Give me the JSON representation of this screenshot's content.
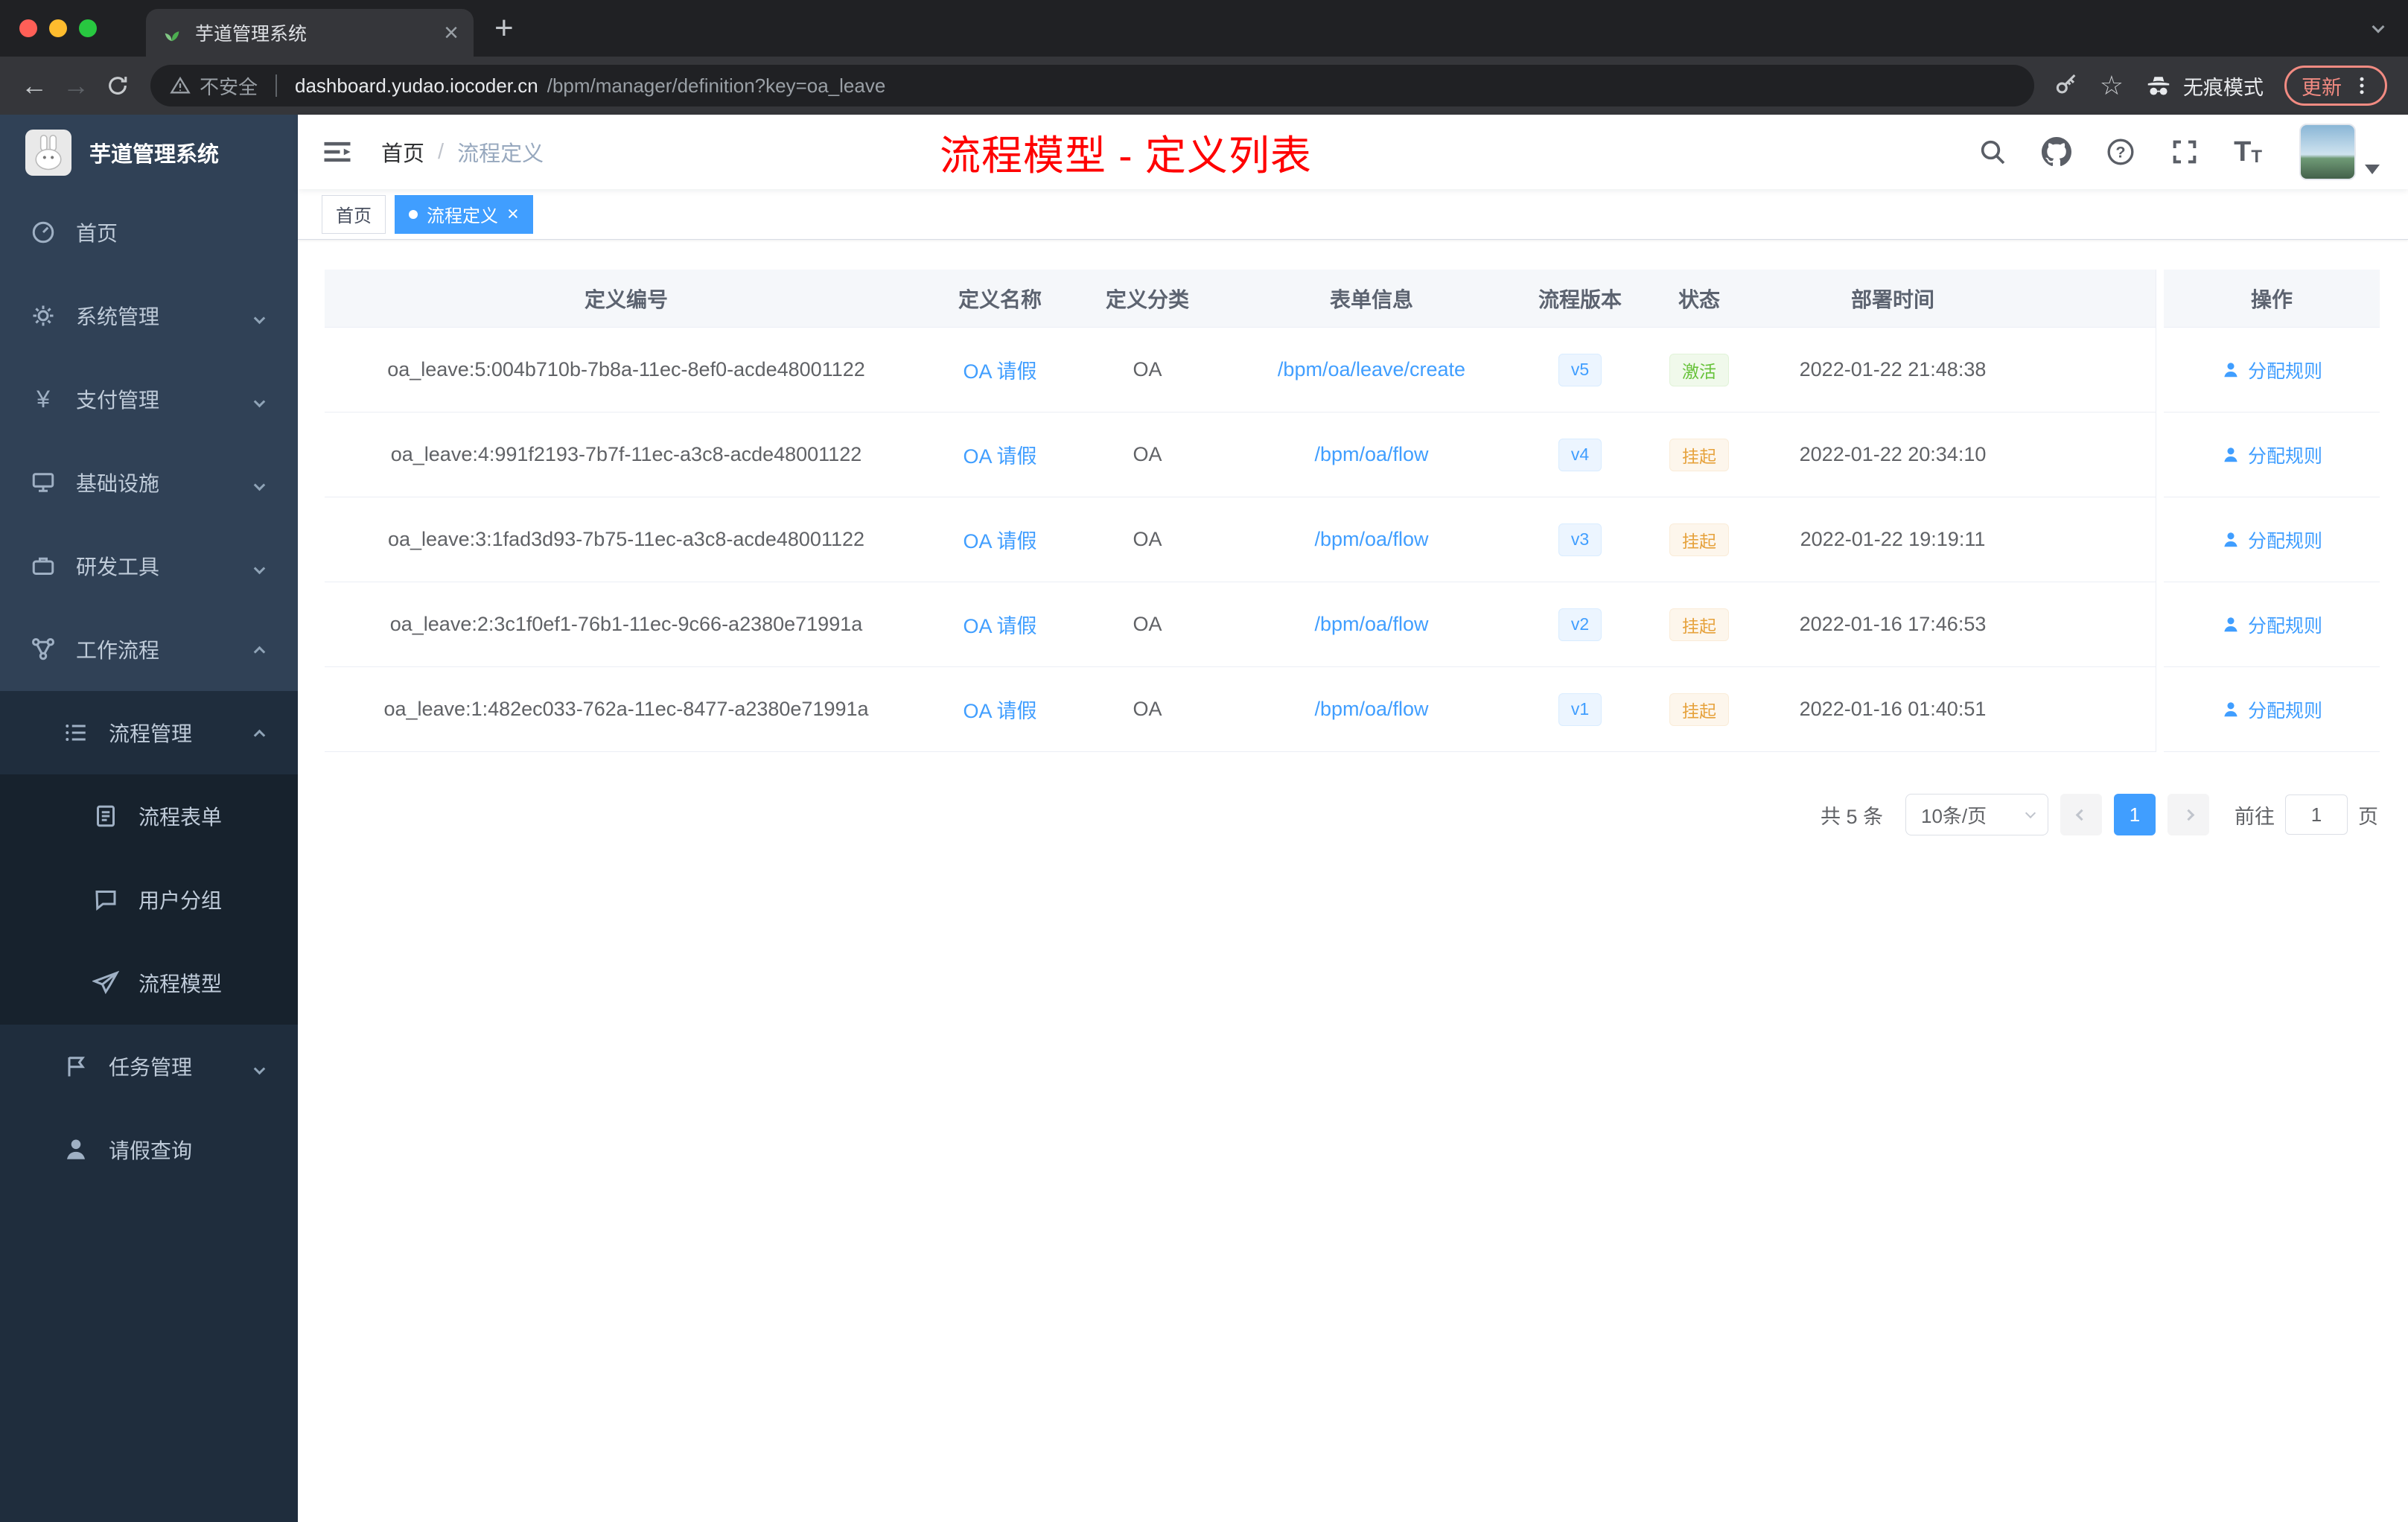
{
  "colors": {
    "primary": "#409eff",
    "success": "#67c23a",
    "warning": "#e6a23c",
    "annotation_red": "#ff0000",
    "sidebar_bg": "#304156",
    "sidebar_sub_bg": "#1f2d3d"
  },
  "browser": {
    "tab_title": "芋道管理系统",
    "security_label": "不安全",
    "url_host": "dashboard.yudao.iocoder.cn",
    "url_path": "/bpm/manager/definition?key=oa_leave",
    "incognito_label": "无痕模式",
    "update_label": "更新"
  },
  "icons": {
    "close": "×",
    "plus": "+",
    "star": "☆",
    "back": "←",
    "forward": "→",
    "yen": "¥",
    "t_big": "T",
    "t_small": "T"
  },
  "sidebar": {
    "logo_title": "芋道管理系统",
    "items": [
      {
        "label": "首页"
      },
      {
        "label": "系统管理"
      },
      {
        "label": "支付管理"
      },
      {
        "label": "基础设施"
      },
      {
        "label": "研发工具"
      },
      {
        "label": "工作流程"
      },
      {
        "label": "流程管理"
      },
      {
        "label": "流程表单"
      },
      {
        "label": "用户分组"
      },
      {
        "label": "流程模型"
      },
      {
        "label": "任务管理"
      },
      {
        "label": "请假查询"
      }
    ]
  },
  "navbar": {
    "breadcrumb_home": "首页",
    "breadcrumb_sep": "/",
    "breadcrumb_current": "流程定义",
    "annotation": "流程模型 - 定义列表"
  },
  "tags": {
    "home": "首页",
    "current": "流程定义"
  },
  "table": {
    "columns": [
      "定义编号",
      "定义名称",
      "定义分类",
      "表单信息",
      "流程版本",
      "状态",
      "部署时间",
      "操作"
    ],
    "rows": [
      {
        "id": "oa_leave:5:004b710b-7b8a-11ec-8ef0-acde48001122",
        "name": "OA 请假",
        "category": "OA",
        "form": "/bpm/oa/leave/create",
        "version": "v5",
        "status": "激活",
        "time": "2022-01-22 21:48:38",
        "action": "分配规则"
      },
      {
        "id": "oa_leave:4:991f2193-7b7f-11ec-a3c8-acde48001122",
        "name": "OA 请假",
        "category": "OA",
        "form": "/bpm/oa/flow",
        "version": "v4",
        "status": "挂起",
        "time": "2022-01-22 20:34:10",
        "action": "分配规则"
      },
      {
        "id": "oa_leave:3:1fad3d93-7b75-11ec-a3c8-acde48001122",
        "name": "OA 请假",
        "category": "OA",
        "form": "/bpm/oa/flow",
        "version": "v3",
        "status": "挂起",
        "time": "2022-01-22 19:19:11",
        "action": "分配规则"
      },
      {
        "id": "oa_leave:2:3c1f0ef1-76b1-11ec-9c66-a2380e71991a",
        "name": "OA 请假",
        "category": "OA",
        "form": "/bpm/oa/flow",
        "version": "v2",
        "status": "挂起",
        "time": "2022-01-16 17:46:53",
        "action": "分配规则"
      },
      {
        "id": "oa_leave:1:482ec033-762a-11ec-8477-a2380e71991a",
        "name": "OA 请假",
        "category": "OA",
        "form": "/bpm/oa/flow",
        "version": "v1",
        "status": "挂起",
        "time": "2022-01-16 01:40:51",
        "action": "分配规则"
      }
    ]
  },
  "pagination": {
    "total": "共 5 条",
    "page_size": "10条/页",
    "page": "1",
    "goto_label": "前往",
    "goto_value": "1",
    "unit": "页"
  }
}
